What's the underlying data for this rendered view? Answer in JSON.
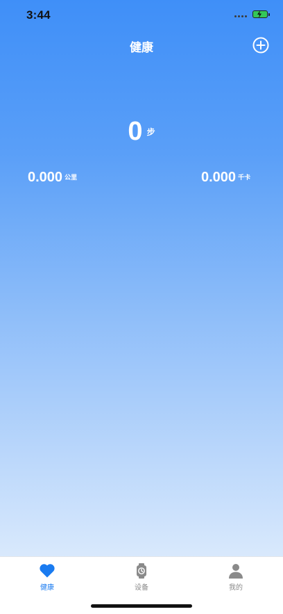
{
  "status_bar": {
    "time": "3:44",
    "battery_color": "#34c759"
  },
  "header": {
    "title": "健康",
    "add_icon": "plus-circle-icon"
  },
  "summary": {
    "steps_value": "0",
    "steps_unit": "步",
    "distance_value": "0.000",
    "distance_unit": "公里",
    "calories_value": "0.000",
    "calories_unit": "千卡"
  },
  "tab_bar": {
    "active_color": "#1a7bf0",
    "inactive_color": "#8a8a8a",
    "tabs": [
      {
        "label": "健康",
        "icon": "heart-icon",
        "active": true
      },
      {
        "label": "设备",
        "icon": "watch-icon",
        "active": false
      },
      {
        "label": "我的",
        "icon": "person-icon",
        "active": false
      }
    ]
  },
  "theme": {
    "gradient_top": "#3f8ff8",
    "gradient_bottom": "#eaf3fd"
  }
}
